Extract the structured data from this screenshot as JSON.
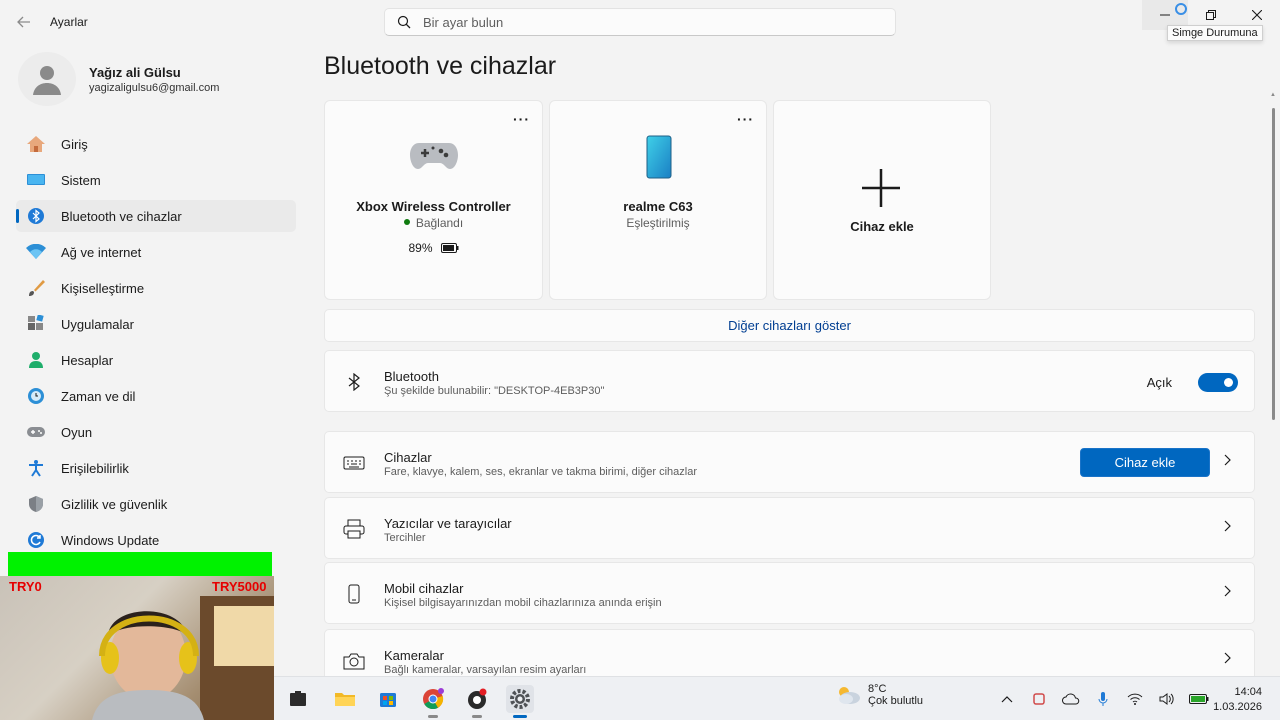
{
  "app": {
    "title": "Ayarlar",
    "search_placeholder": "Bir ayar bulun",
    "minimize_tooltip": "Simge Durumuna"
  },
  "profile": {
    "name": "Yağız ali Gülsu",
    "email": "yagizaligulsu6@gmail.com"
  },
  "nav": {
    "items": [
      {
        "label": "Giriş",
        "icon": "home-icon"
      },
      {
        "label": "Sistem",
        "icon": "monitor-icon"
      },
      {
        "label": "Bluetooth ve cihazlar",
        "icon": "bluetooth-icon",
        "active": true
      },
      {
        "label": "Ağ ve internet",
        "icon": "wifi-icon"
      },
      {
        "label": "Kişiselleştirme",
        "icon": "brush-icon"
      },
      {
        "label": "Uygulamalar",
        "icon": "apps-icon"
      },
      {
        "label": "Hesaplar",
        "icon": "person-icon"
      },
      {
        "label": "Zaman ve dil",
        "icon": "globe-clock-icon"
      },
      {
        "label": "Oyun",
        "icon": "gamepad-icon"
      },
      {
        "label": "Erişilebilirlik",
        "icon": "accessibility-icon"
      },
      {
        "label": "Gizlilik ve güvenlik",
        "icon": "shield-icon"
      },
      {
        "label": "Windows Update",
        "icon": "update-icon"
      }
    ]
  },
  "main": {
    "title": "Bluetooth ve cihazlar",
    "devices": [
      {
        "name": "Xbox Wireless Controller",
        "status": "Bağlandı",
        "battery": "89%",
        "icon": "gamepad-icon"
      },
      {
        "name": "realme C63",
        "status": "Eşleştirilmiş",
        "icon": "phone-icon"
      }
    ],
    "add_device_card": "Cihaz ekle",
    "more_menu": "···",
    "show_more": "Diğer cihazları göster",
    "bluetooth": {
      "title": "Bluetooth",
      "subtitle": "Şu şekilde bulunabilir: \"DESKTOP-4EB3P30\"",
      "state_label": "Açık",
      "enabled": true
    },
    "rows": [
      {
        "title": "Cihazlar",
        "subtitle": "Fare, klavye, kalem, ses, ekranlar ve takma birimi, diğer cihazlar",
        "button": "Cihaz ekle",
        "icon": "keyboard-icon"
      },
      {
        "title": "Yazıcılar ve tarayıcılar",
        "subtitle": "Tercihler",
        "icon": "printer-icon"
      },
      {
        "title": "Mobil cihazlar",
        "subtitle": "Kişisel bilgisayarınızdan mobil cihazlarınıza anında erişin",
        "icon": "mobile-icon"
      },
      {
        "title": "Kameralar",
        "subtitle": "Bağlı kameralar, varsayılan resim ayarları",
        "icon": "camera-icon"
      }
    ]
  },
  "overlay": {
    "donate_min": "TRY0",
    "donate_max": "TRY5000"
  },
  "taskbar": {
    "weather_temp": "8°C",
    "weather_desc": "Çok bulutlu",
    "time": "14:04",
    "date": "1.03.2026"
  },
  "colors": {
    "accent": "#0067c0",
    "link": "#003e92",
    "connected": "#0f7b0f",
    "overlay_green": "#00f200",
    "overlay_red": "#e60000"
  }
}
